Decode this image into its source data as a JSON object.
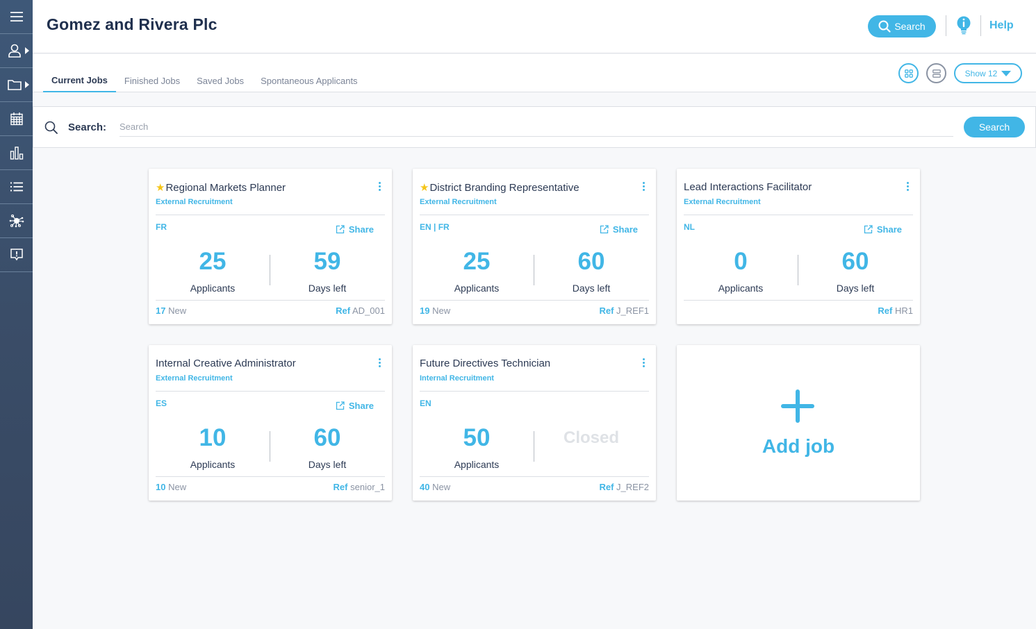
{
  "app": {
    "company_name": "Gomez and Rivera Plc",
    "brand_color": "#41b6e6",
    "sidebar_color": "#3e5878"
  },
  "sidebar": {
    "items": [
      {
        "name": "menu",
        "icon": "hamburger-menu-icon"
      },
      {
        "name": "candidates",
        "icon": "user-icon",
        "has_submenu": true
      },
      {
        "name": "jobs",
        "icon": "folder-icon",
        "has_submenu": true
      },
      {
        "name": "calendar",
        "icon": "calendar-icon"
      },
      {
        "name": "statistics",
        "icon": "bar-chart-icon"
      },
      {
        "name": "list",
        "icon": "list-icon"
      },
      {
        "name": "network",
        "icon": "network-icon"
      },
      {
        "name": "feedback",
        "icon": "feedback-icon"
      }
    ]
  },
  "header": {
    "search_label": "Search",
    "help_label": "Help",
    "info_icon": "lightbulb-info-icon"
  },
  "tabs": [
    {
      "label": "Current Jobs",
      "active": true
    },
    {
      "label": "Finished Jobs",
      "active": false
    },
    {
      "label": "Saved Jobs",
      "active": false
    },
    {
      "label": "Spontaneous Applicants",
      "active": false
    }
  ],
  "view_controls": {
    "grid_view": "grid-view-icon",
    "list_view": "list-view-icon",
    "show_label": "Show 12"
  },
  "search": {
    "label": "Search:",
    "placeholder": "Search",
    "value": "",
    "button_label": "Search"
  },
  "jobs": [
    {
      "title": "Regional Markets Planner",
      "starred": true,
      "recruitment_type": "External Recruitment",
      "languages": "FR",
      "share_label": "Share",
      "applicants": "25",
      "applicants_label": "Applicants",
      "days_left": "59",
      "days_left_label": "Days left",
      "new_count": "17",
      "new_label": "New",
      "ref_label": "Ref",
      "ref": "AD_001"
    },
    {
      "title": "District Branding Representative",
      "starred": true,
      "recruitment_type": "External Recruitment",
      "languages": "EN | FR",
      "share_label": "Share",
      "applicants": "25",
      "applicants_label": "Applicants",
      "days_left": "60",
      "days_left_label": "Days left",
      "new_count": "19",
      "new_label": "New",
      "ref_label": "Ref",
      "ref": "J_REF1"
    },
    {
      "title": "Lead Interactions Facilitator",
      "starred": false,
      "recruitment_type": "External Recruitment",
      "languages": "NL",
      "share_label": "Share",
      "applicants": "0",
      "applicants_label": "Applicants",
      "days_left": "60",
      "days_left_label": "Days left",
      "new_count": null,
      "new_label": null,
      "ref_label": "Ref",
      "ref": "HR1"
    },
    {
      "title": "Internal Creative Administrator",
      "starred": false,
      "recruitment_type": "External Recruitment",
      "languages": "ES",
      "share_label": "Share",
      "applicants": "10",
      "applicants_label": "Applicants",
      "days_left": "60",
      "days_left_label": "Days left",
      "new_count": "10",
      "new_label": "New",
      "ref_label": "Ref",
      "ref": "senior_1"
    },
    {
      "title": "Future Directives Technician",
      "starred": false,
      "recruitment_type": "Internal Recruitment",
      "languages": "EN",
      "share_label": null,
      "applicants": "50",
      "applicants_label": "Applicants",
      "status": "Closed",
      "new_count": "40",
      "new_label": "New",
      "ref_label": "Ref",
      "ref": "J_REF2"
    }
  ],
  "add_job": {
    "label": "Add job"
  }
}
